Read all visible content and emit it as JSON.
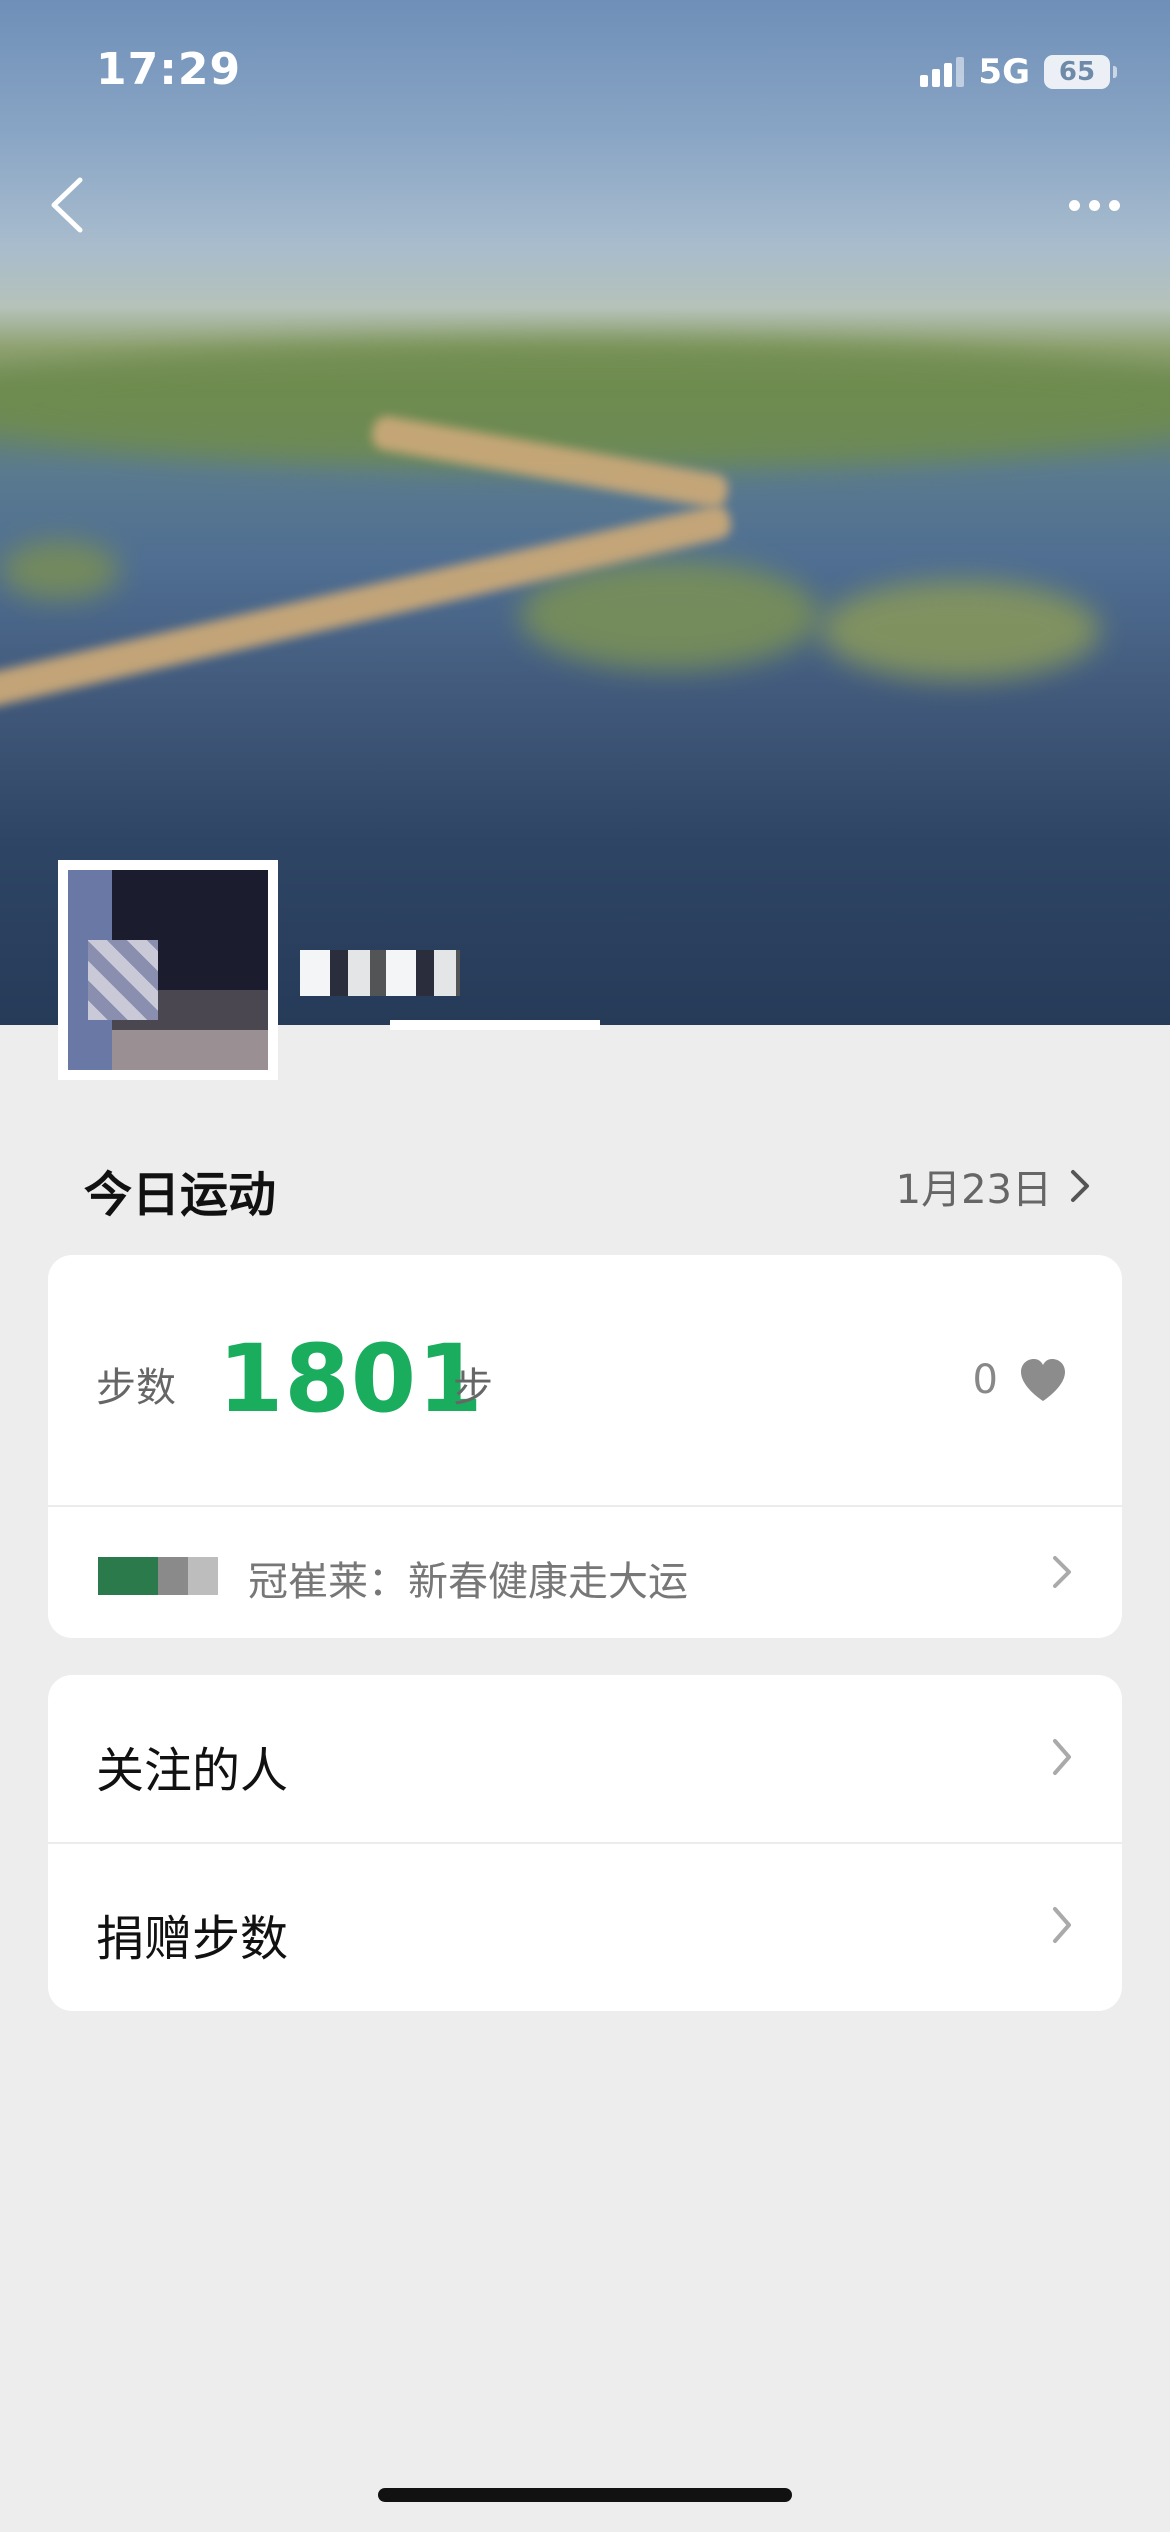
{
  "status_bar": {
    "time": "17:29",
    "network": "5G",
    "battery": "65"
  },
  "header": {
    "back_icon": "chevron-left-icon",
    "more_icon": "more-dots-icon"
  },
  "profile": {
    "nickname": ""
  },
  "today": {
    "heading": "今日运动",
    "date": "1月23日"
  },
  "steps_card": {
    "steps_label": "步数",
    "steps_value": "1801",
    "steps_unit": "步",
    "like_count": "0",
    "campaign_text": "冠崔莱：新春健康走大运"
  },
  "menu": {
    "items": [
      {
        "label": "关注的人"
      },
      {
        "label": "捐赠步数"
      }
    ]
  },
  "colors": {
    "accent": "#1aad5e",
    "background": "#ededed"
  }
}
